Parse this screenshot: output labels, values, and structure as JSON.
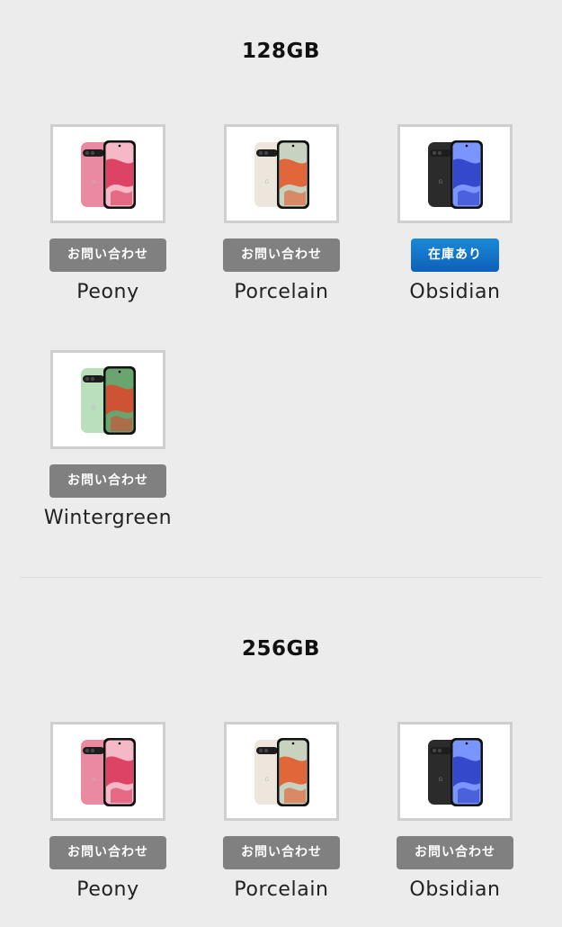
{
  "sections": [
    {
      "title": "128GB",
      "items": [
        {
          "name": "Peony",
          "badge": "お問い合わせ",
          "status": "inquiry",
          "body_color": "#e98aa0",
          "screen_color": "#d9365a",
          "accent": "#f4b8c6"
        },
        {
          "name": "Porcelain",
          "badge": "お問い合わせ",
          "status": "inquiry",
          "body_color": "#ece6dc",
          "screen_color": "#e35a2a",
          "accent": "#c7d3c0"
        },
        {
          "name": "Obsidian",
          "badge": "在庫あり",
          "status": "in-stock",
          "body_color": "#2b2b2b",
          "screen_color": "#2b3fc4",
          "accent": "#7b95ff"
        },
        {
          "name": "Wintergreen",
          "badge": "お問い合わせ",
          "status": "inquiry",
          "body_color": "#b9dfbc",
          "screen_color": "#d94a2e",
          "accent": "#6aa56f"
        }
      ]
    },
    {
      "title": "256GB",
      "items": [
        {
          "name": "Peony",
          "badge": "お問い合わせ",
          "status": "inquiry",
          "body_color": "#e98aa0",
          "screen_color": "#d9365a",
          "accent": "#f4b8c6"
        },
        {
          "name": "Porcelain",
          "badge": "お問い合わせ",
          "status": "inquiry",
          "body_color": "#ece6dc",
          "screen_color": "#e35a2a",
          "accent": "#c7d3c0"
        },
        {
          "name": "Obsidian",
          "badge": "お問い合わせ",
          "status": "inquiry",
          "body_color": "#2b2b2b",
          "screen_color": "#2b3fc4",
          "accent": "#7b95ff"
        }
      ]
    }
  ],
  "colors": {
    "background": "#ececec",
    "badge_inquiry": "#808080",
    "badge_in_stock": "#1273c9",
    "thumb_border": "#cfcfcf"
  },
  "icons": {
    "product_image": "phone-image-icon"
  }
}
